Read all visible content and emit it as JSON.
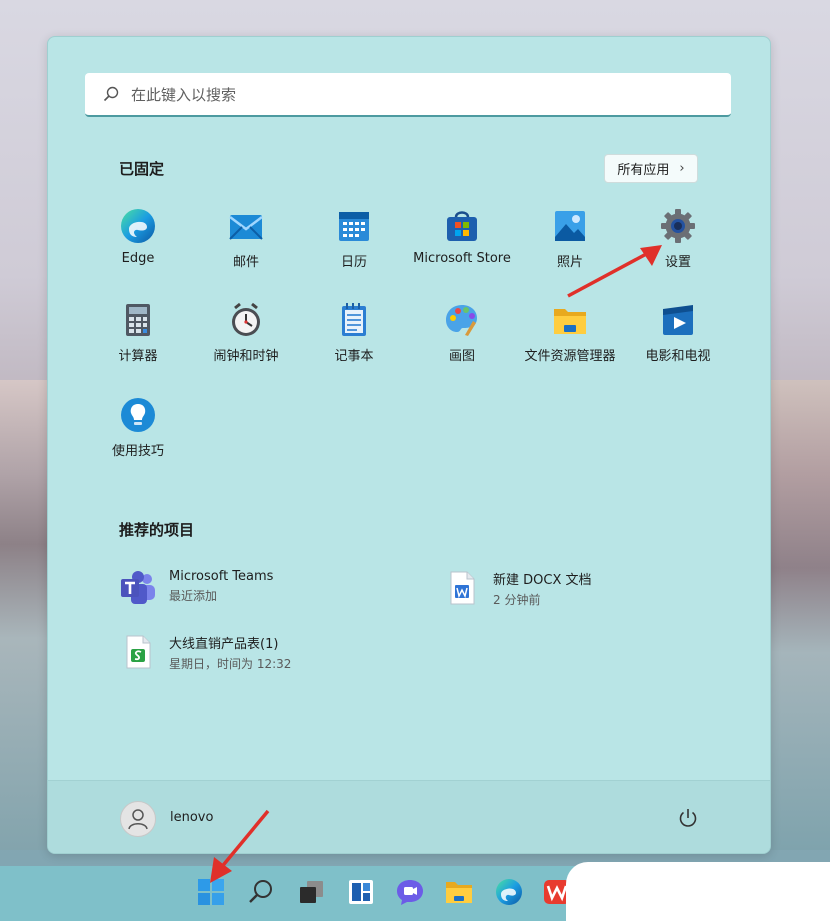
{
  "search": {
    "placeholder": "在此键入以搜索"
  },
  "pinned": {
    "title": "已固定",
    "all_apps_label": "所有应用",
    "apps": [
      {
        "label": "Edge",
        "icon": "edge-icon"
      },
      {
        "label": "邮件",
        "icon": "mail-icon"
      },
      {
        "label": "日历",
        "icon": "calendar-icon"
      },
      {
        "label": "Microsoft Store",
        "icon": "store-icon"
      },
      {
        "label": "照片",
        "icon": "photos-icon"
      },
      {
        "label": "设置",
        "icon": "settings-gear-icon"
      },
      {
        "label": "计算器",
        "icon": "calculator-icon"
      },
      {
        "label": "闹钟和时钟",
        "icon": "clock-icon"
      },
      {
        "label": "记事本",
        "icon": "notepad-icon"
      },
      {
        "label": "画图",
        "icon": "paint-icon"
      },
      {
        "label": "文件资源管理器",
        "icon": "file-explorer-icon"
      },
      {
        "label": "电影和电视",
        "icon": "movies-tv-icon"
      },
      {
        "label": "使用技巧",
        "icon": "tips-icon"
      }
    ]
  },
  "recommended": {
    "title": "推荐的项目",
    "items": [
      {
        "name": "Microsoft Teams",
        "sub": "最近添加",
        "icon": "teams-icon"
      },
      {
        "name": "新建 DOCX 文档",
        "sub": "2 分钟前",
        "icon": "docx-icon"
      },
      {
        "name": "大线直销产品表(1)",
        "sub": "星期日，时间为 12:32",
        "icon": "spreadsheet-icon"
      }
    ]
  },
  "user": {
    "name": "lenovo"
  },
  "colors": {
    "menu_bg": "#b9e5e6",
    "taskbar_bg": "#7fc0c9",
    "annotation_arrow": "#e0302a"
  },
  "taskbar": {
    "icons": [
      "windows-start-icon",
      "search-icon",
      "task-view-icon",
      "widgets-icon",
      "chat-icon",
      "file-explorer-icon",
      "edge-icon",
      "wps-icon"
    ]
  }
}
